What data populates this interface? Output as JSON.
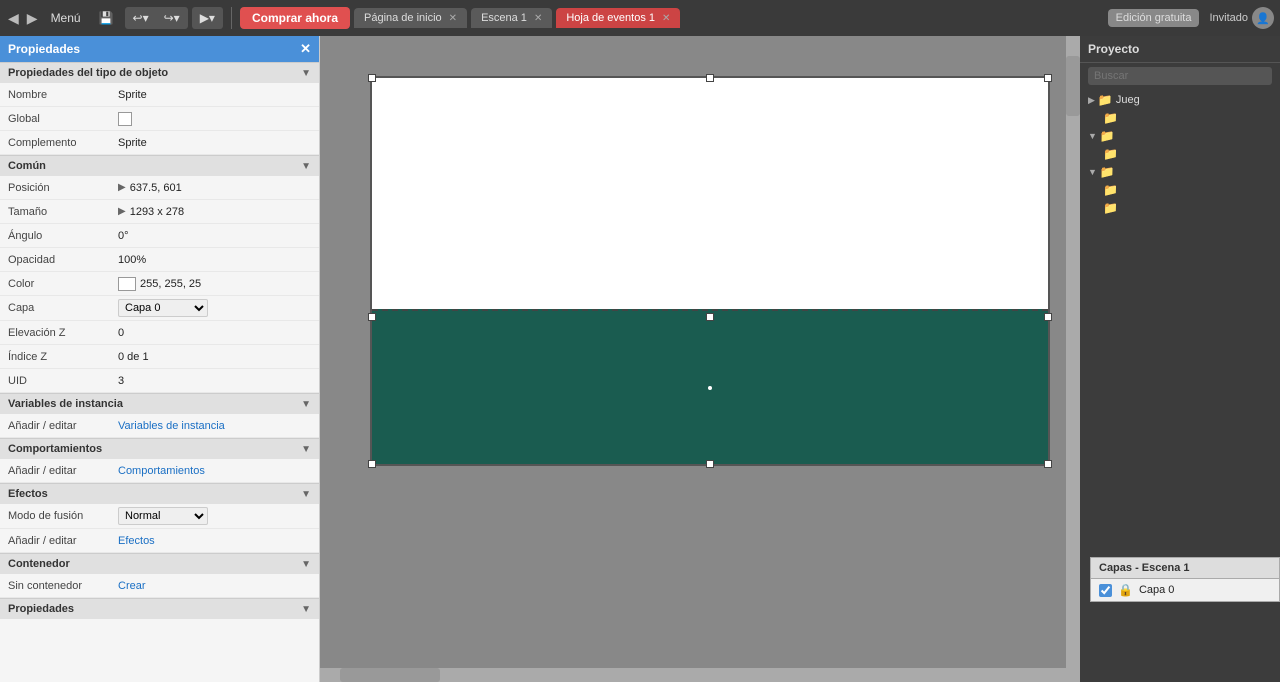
{
  "toolbar": {
    "menu_label": "Menú",
    "undo_label": "↩",
    "redo_label": "↪",
    "play_label": "▶",
    "buy_label": "Comprar ahora",
    "tabs": [
      {
        "label": "Página de inicio",
        "closable": true,
        "active": false
      },
      {
        "label": "Escena 1",
        "closable": true,
        "active": false
      },
      {
        "label": "Hoja de eventos 1",
        "closable": true,
        "active": true
      }
    ],
    "edition_label": "Edición gratuita",
    "user_label": "Invitado"
  },
  "properties_panel": {
    "title": "Propiedades",
    "object_type_section": "Propiedades del tipo de objeto",
    "fields": {
      "nombre_label": "Nombre",
      "nombre_value": "Sprite",
      "global_label": "Global",
      "complemento_label": "Complemento",
      "complemento_value": "Sprite"
    },
    "common_section": "Común",
    "common_fields": {
      "posicion_label": "Posición",
      "posicion_value": "637.5, 601",
      "tamano_label": "Tamaño",
      "tamano_value": "1293 x 278",
      "angulo_label": "Ángulo",
      "angulo_value": "0°",
      "opacidad_label": "Opacidad",
      "opacidad_value": "100%",
      "color_label": "Color",
      "color_value": "255, 255, 25",
      "capa_label": "Capa",
      "capa_value": "Capa 0",
      "elevacion_z_label": "Elevación Z",
      "elevacion_z_value": "0",
      "indice_z_label": "Índice Z",
      "indice_z_value": "0 de 1",
      "uid_label": "UID",
      "uid_value": "3"
    },
    "instance_vars_section": "Variables de instancia",
    "instance_vars_add": "Añadir / editar",
    "instance_vars_link": "Variables de instancia",
    "behaviors_section": "Comportamientos",
    "behaviors_add": "Añadir / editar",
    "behaviors_link": "Comportamientos",
    "effects_section": "Efectos",
    "effects_fields": {
      "modo_fusion_label": "Modo de fusión",
      "modo_fusion_value": "Normal",
      "add_label": "Añadir / editar",
      "effects_link": "Efectos"
    },
    "container_section": "Contenedor",
    "container_fields": {
      "sin_contenedor_label": "Sin contenedor",
      "crear_link": "Crear"
    },
    "propiedades_section": "Propiedades"
  },
  "canvas": {
    "bg_color": "#888888",
    "white_area_bg": "#ffffff",
    "teal_area_bg": "#1a5c50"
  },
  "right_panel": {
    "project_label": "Proyecto",
    "search_placeholder": "Buscar",
    "tree_items": [
      {
        "indent": 0,
        "arrow": "▶",
        "icon": "📁",
        "label": "Jueg",
        "expanded": false
      },
      {
        "indent": 1,
        "arrow": "",
        "icon": "📁",
        "label": "",
        "expanded": false
      },
      {
        "indent": 0,
        "arrow": "▼",
        "icon": "📁",
        "label": "",
        "expanded": true
      },
      {
        "indent": 1,
        "arrow": "",
        "icon": "📁",
        "label": "",
        "expanded": false
      },
      {
        "indent": 0,
        "arrow": "▼",
        "icon": "📁",
        "label": "",
        "expanded": true
      },
      {
        "indent": 1,
        "arrow": "",
        "icon": "📁",
        "label": "",
        "expanded": false
      },
      {
        "indent": 1,
        "arrow": "",
        "icon": "📁",
        "label": "",
        "expanded": false
      }
    ]
  },
  "layers_panel": {
    "title": "Capas - Escena 1",
    "layers": [
      {
        "checked": true,
        "locked": true,
        "name": "Capa 0"
      }
    ]
  }
}
